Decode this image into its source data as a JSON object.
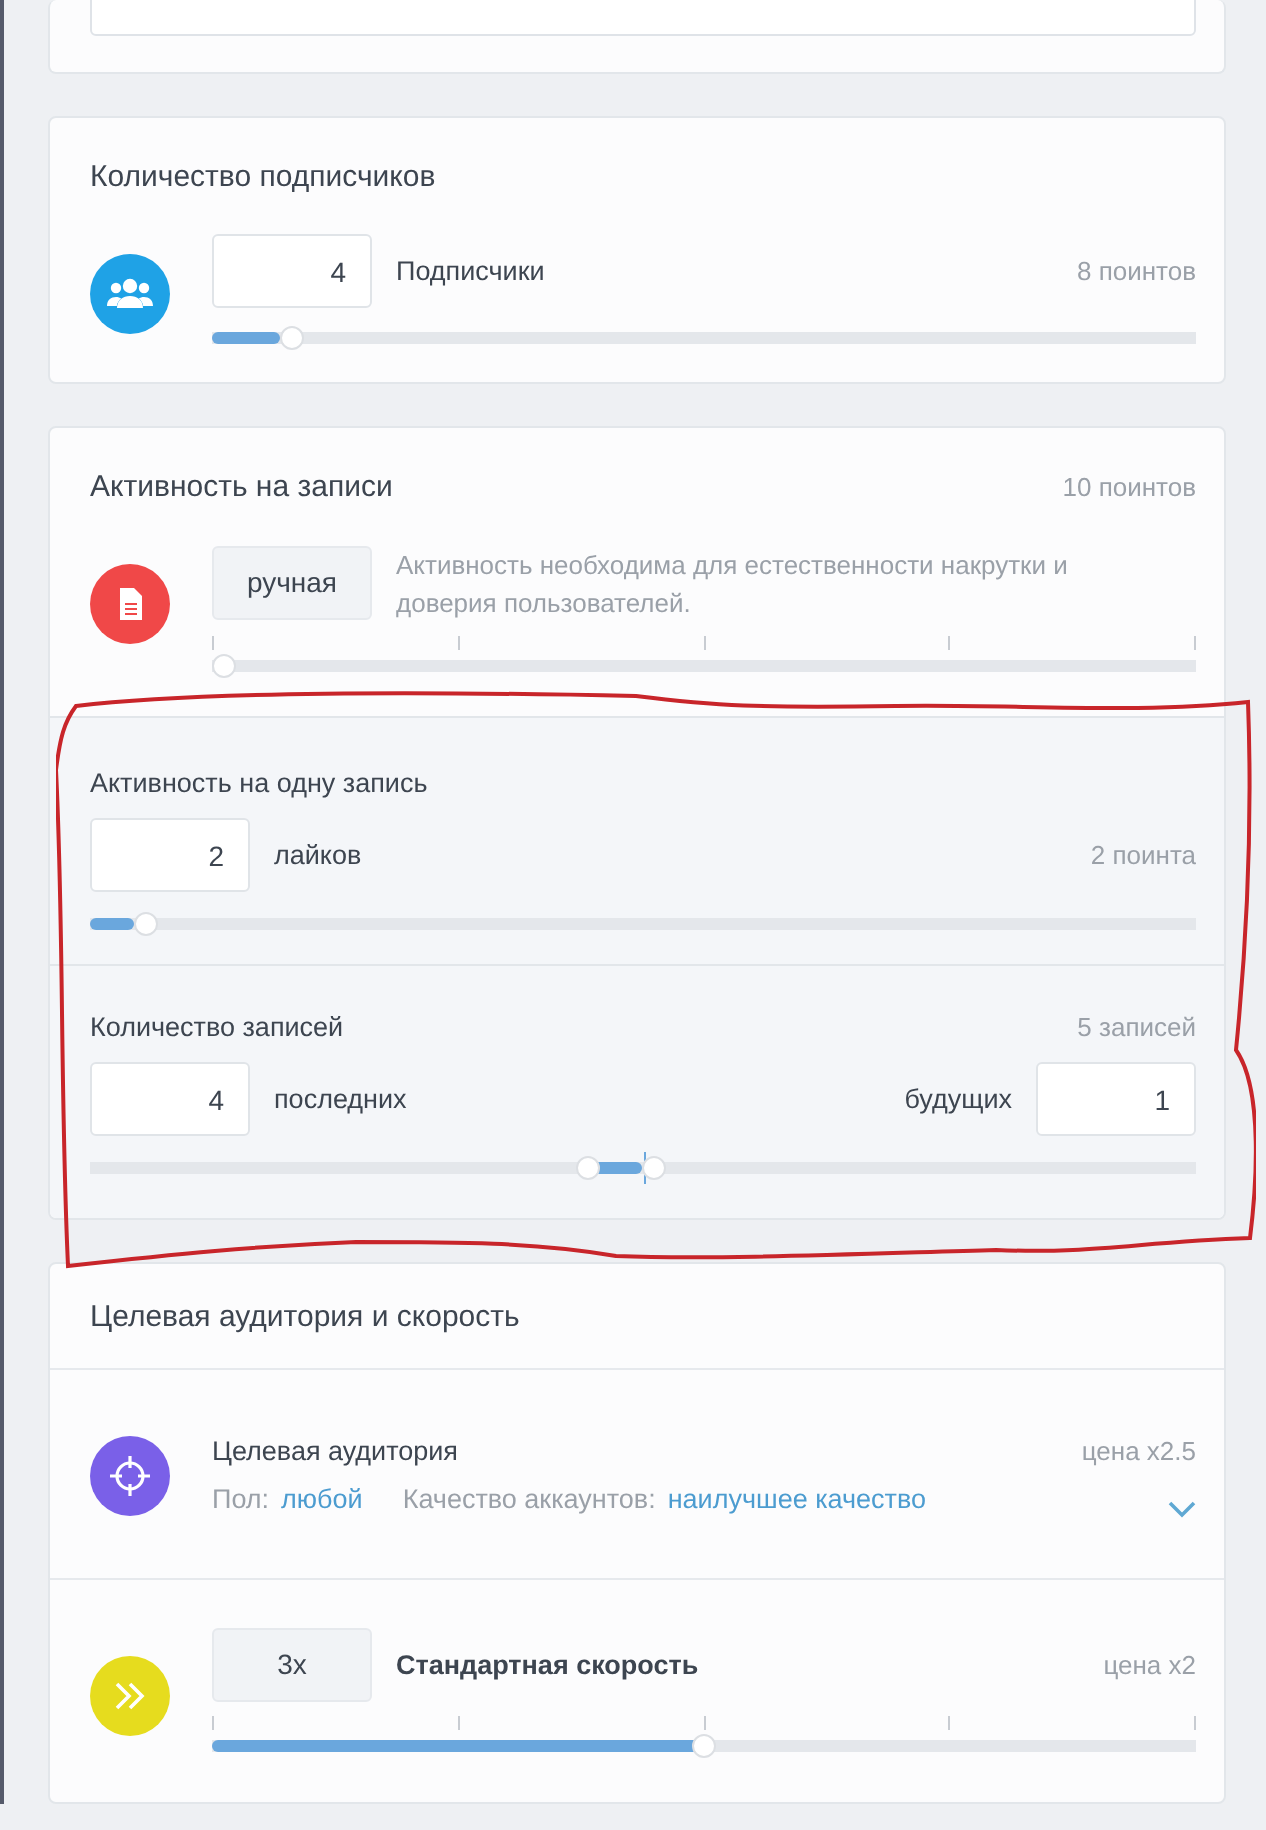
{
  "subscribers": {
    "title": "Количество подписчиков",
    "value": "4",
    "label": "Подписчики",
    "points": "8 поинтов",
    "level": 0.07
  },
  "activity": {
    "title": "Активность на записи",
    "points": "10 поинтов",
    "mode": "ручная",
    "description": "Активность необходима для естественности накрутки и доверия пользователей.",
    "level": 0,
    "per_post": {
      "title": "Активность на одну запись",
      "value": "2",
      "unit": "лайков",
      "points": "2 поинта",
      "level": 0.04
    },
    "posts": {
      "title": "Количество записей",
      "count": "5 записей",
      "last_value": "4",
      "last_label": "последних",
      "future_label": "будущих",
      "future_value": "1",
      "thumbs": [
        {
          "level": 0.45
        },
        {
          "level": 0.51
        }
      ]
    },
    "highlighted": true
  },
  "audience": {
    "title": "Целевая аудитория и скорость",
    "target": {
      "title": "Целевая аудитория",
      "price": "цена x2.5",
      "gender_label": "Пол:",
      "gender_value": "любой",
      "quality_label": "Качество аккаунтов:",
      "quality_value": "наилучшее качество",
      "expanded": false
    },
    "speed": {
      "value": "3x",
      "label": "Стандартная скорость",
      "price": "цена x2",
      "level": 0.5
    }
  }
}
